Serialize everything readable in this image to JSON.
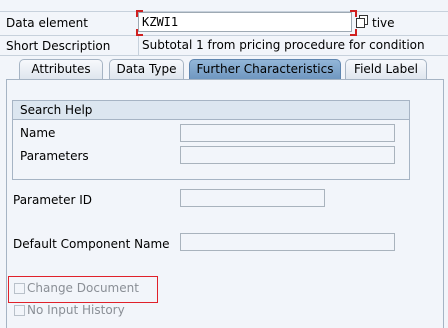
{
  "header": {
    "data_element_label": "Data element",
    "data_element_value": "KZWI1",
    "status_suffix": "tive",
    "short_desc_label": "Short Description",
    "short_desc_value": "Subtotal 1 from pricing procedure for condition"
  },
  "tabs": [
    {
      "label": "Attributes",
      "active": false
    },
    {
      "label": "Data Type",
      "active": false
    },
    {
      "label": "Further Characteristics",
      "active": true
    },
    {
      "label": "Field Label",
      "active": false
    }
  ],
  "search_help": {
    "title": "Search Help",
    "name_label": "Name",
    "name_value": "",
    "parameters_label": "Parameters",
    "parameters_value": ""
  },
  "fields": {
    "parameter_id_label": "Parameter ID",
    "parameter_id_value": "",
    "default_component_label": "Default Component Name",
    "default_component_value": ""
  },
  "checkboxes": {
    "change_document_label": "Change Document",
    "change_document_checked": false,
    "no_input_history_label": "No Input History",
    "no_input_history_checked": false
  },
  "colors": {
    "highlight": "#e0212a",
    "active_tab": "#7fa4cc"
  }
}
